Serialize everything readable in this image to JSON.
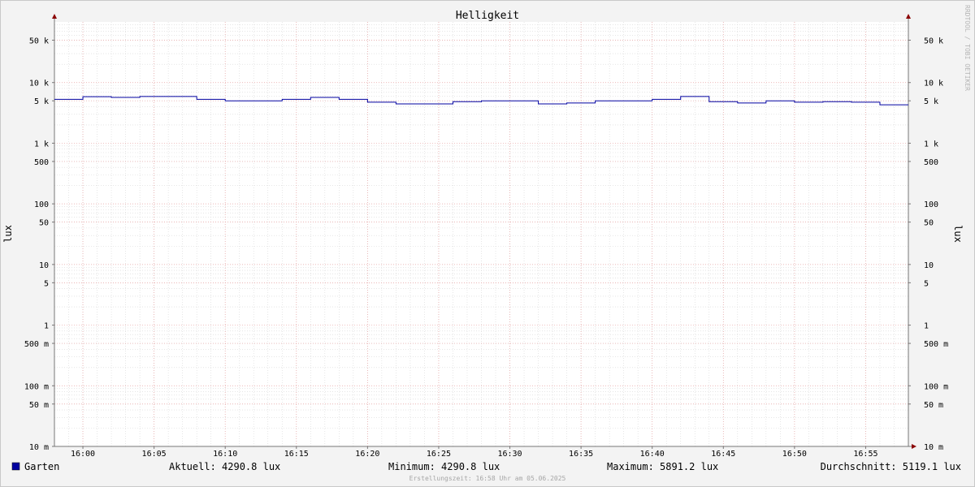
{
  "chart_data": {
    "type": "line",
    "title": "Helligkeit",
    "ylabel": "lux",
    "yscale": "log",
    "ylim": [
      0.01,
      100000
    ],
    "xlim": [
      "15:58",
      "16:58"
    ],
    "y_ticks": [
      {
        "value": 50000,
        "label": "50 k"
      },
      {
        "value": 10000,
        "label": "10 k"
      },
      {
        "value": 5000,
        "label": "5 k"
      },
      {
        "value": 1000,
        "label": "1 k"
      },
      {
        "value": 500,
        "label": "500"
      },
      {
        "value": 100,
        "label": "100"
      },
      {
        "value": 50,
        "label": "50"
      },
      {
        "value": 10,
        "label": "10"
      },
      {
        "value": 5,
        "label": "5"
      },
      {
        "value": 1,
        "label": "1"
      },
      {
        "value": 0.5,
        "label": "500 m"
      },
      {
        "value": 0.1,
        "label": "100 m"
      },
      {
        "value": 0.05,
        "label": "50 m"
      },
      {
        "value": 0.01,
        "label": "10 m"
      }
    ],
    "x_ticks": [
      "16:00",
      "16:05",
      "16:10",
      "16:15",
      "16:20",
      "16:25",
      "16:30",
      "16:35",
      "16:40",
      "16:45",
      "16:50",
      "16:55"
    ],
    "grid": true,
    "series": [
      {
        "name": "Garten",
        "color": "#0000a0",
        "step": true,
        "x": [
          "15:58",
          "16:00",
          "16:02",
          "16:04",
          "16:06",
          "16:08",
          "16:10",
          "16:12",
          "16:14",
          "16:16",
          "16:18",
          "16:20",
          "16:22",
          "16:24",
          "16:26",
          "16:28",
          "16:30",
          "16:32",
          "16:34",
          "16:36",
          "16:38",
          "16:40",
          "16:42",
          "16:44",
          "16:46",
          "16:48",
          "16:50",
          "16:52",
          "16:54",
          "16:56"
        ],
        "values": [
          5300,
          5850,
          5700,
          5890,
          5890,
          5300,
          5000,
          5000,
          5300,
          5700,
          5300,
          4750,
          4450,
          4450,
          4850,
          5000,
          5000,
          4450,
          4600,
          5000,
          5000,
          5300,
          5890,
          4850,
          4600,
          5000,
          4750,
          4850,
          4750,
          4290.8
        ]
      }
    ]
  },
  "vendor_label": "RRDTOOL / TOBI OETIKER",
  "legend": {
    "series_name": "Garten",
    "swatch_color": "#0000a0",
    "aktuell": "Aktuell: 4290.8 lux",
    "minimum": "Minimum: 4290.8 lux",
    "maximum": "Maximum: 5891.2 lux",
    "durchschnitt": "Durchschnitt: 5119.1 lux"
  },
  "footer": "Erstellungszeit: 16:58 Uhr am 05.06.2025"
}
